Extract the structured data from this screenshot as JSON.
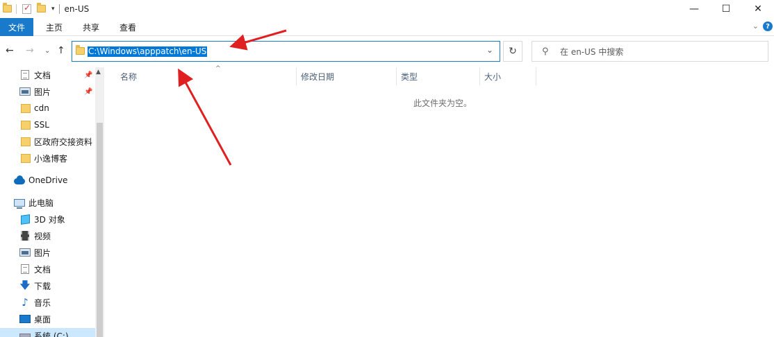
{
  "window": {
    "title": "en-US",
    "controls": {
      "minimize": "—",
      "maximize": "☐",
      "close": "✕"
    }
  },
  "ribbon": {
    "tabs": [
      "文件",
      "主页",
      "共享",
      "查看"
    ],
    "help": "?"
  },
  "address_bar": {
    "path": "C:\\Windows\\apppatch\\en-US"
  },
  "search": {
    "placeholder": "在 en-US 中搜索"
  },
  "nav_pane": {
    "quick_access": [
      {
        "label": "文档",
        "icon": "document-icon",
        "pinned": true
      },
      {
        "label": "图片",
        "icon": "picture-icon",
        "pinned": true
      },
      {
        "label": "cdn",
        "icon": "folder-icon"
      },
      {
        "label": "SSL",
        "icon": "folder-icon"
      },
      {
        "label": "区政府交接资料",
        "icon": "folder-icon"
      },
      {
        "label": "小逸博客",
        "icon": "folder-icon"
      }
    ],
    "onedrive": {
      "label": "OneDrive",
      "icon": "cloud-icon"
    },
    "this_pc": {
      "label": "此电脑",
      "icon": "computer-icon",
      "items": [
        {
          "label": "3D 对象",
          "icon": "cube-icon"
        },
        {
          "label": "视频",
          "icon": "video-icon"
        },
        {
          "label": "图片",
          "icon": "picture-icon"
        },
        {
          "label": "文档",
          "icon": "document-icon"
        },
        {
          "label": "下载",
          "icon": "download-icon"
        },
        {
          "label": "音乐",
          "icon": "music-icon"
        },
        {
          "label": "桌面",
          "icon": "desktop-icon"
        },
        {
          "label": "系统 (C:)",
          "icon": "drive-icon",
          "selected": true
        }
      ]
    }
  },
  "file_list": {
    "columns": [
      "名称",
      "修改日期",
      "类型",
      "大小"
    ],
    "empty_message": "此文件夹为空。"
  },
  "colors": {
    "accent": "#1979ca",
    "selection": "#0078d7",
    "annotation": "#e02020"
  }
}
